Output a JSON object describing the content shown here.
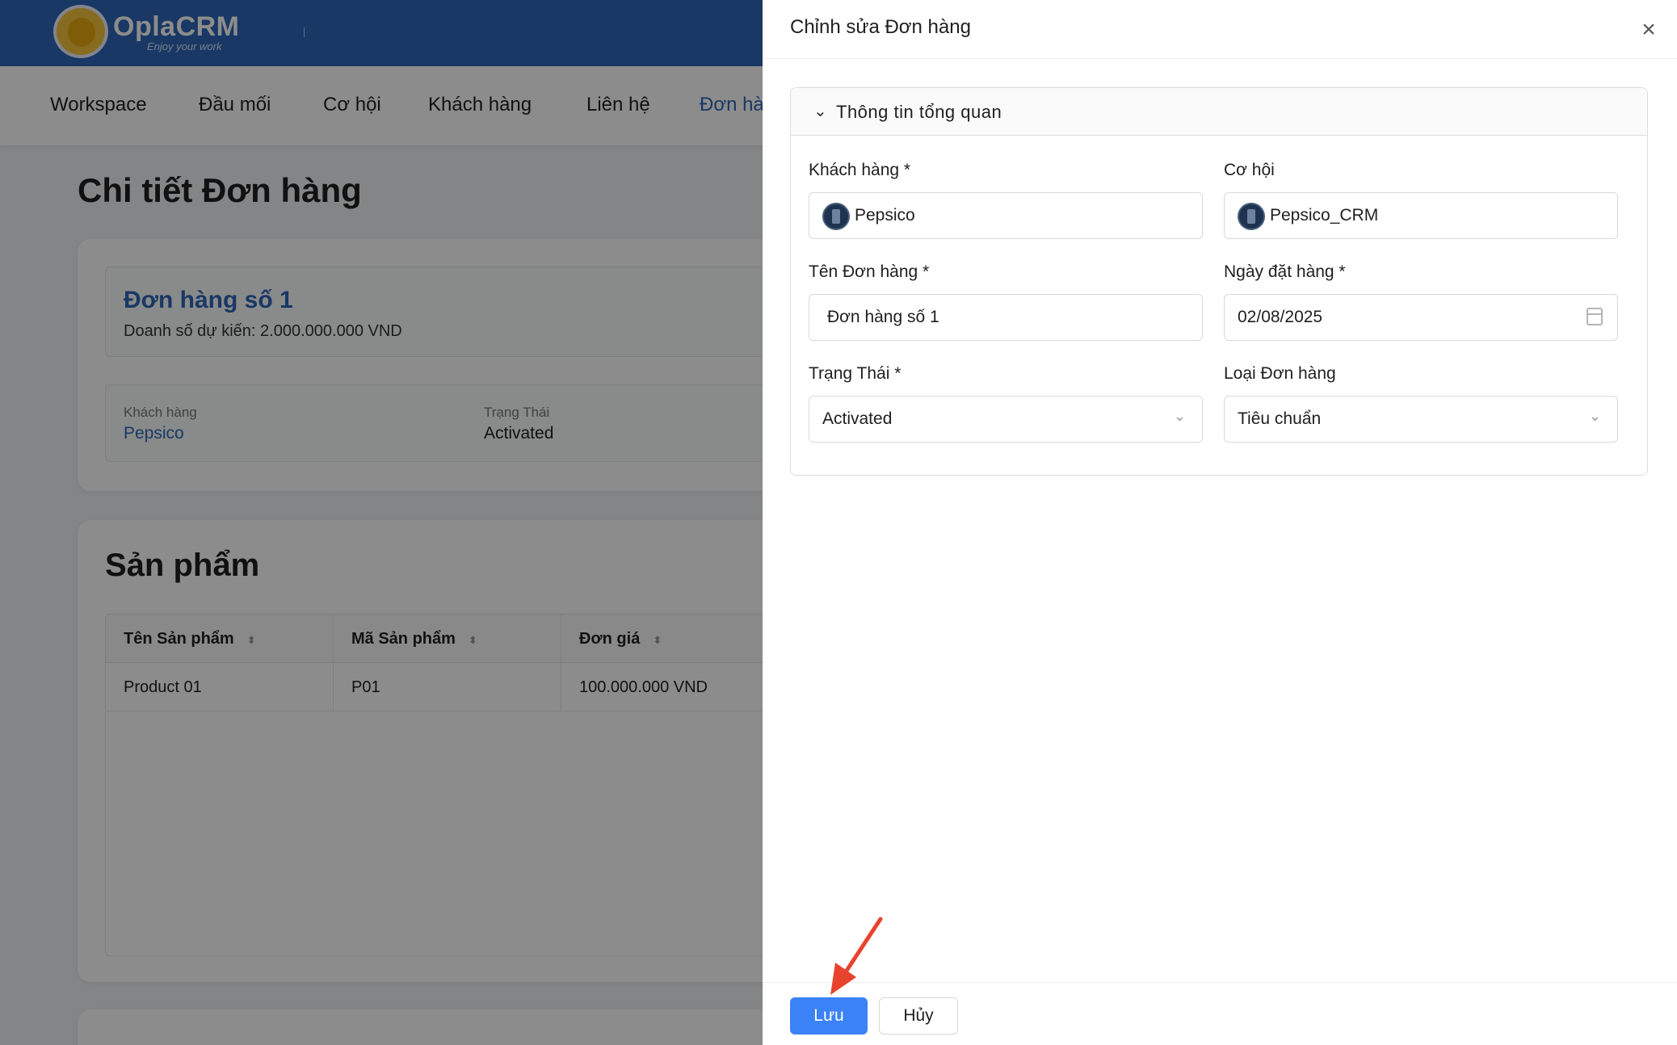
{
  "app": {
    "name": "OplaCRM",
    "tagline": "Enjoy your work"
  },
  "nav": {
    "items": [
      "Workspace",
      "Đầu mối",
      "Cơ hội",
      "Khách hàng",
      "Liên hệ",
      "Đơn hà"
    ]
  },
  "page": {
    "title": "Chi tiết Đơn hàng"
  },
  "order_card": {
    "title": "Đơn hàng số 1",
    "subtitle": "Doanh số dự kiến: 2.000.000.000 VND",
    "customer_label": "Khách hàng",
    "customer_value": "Pepsico",
    "status_label": "Trạng Thái",
    "status_value": "Activated"
  },
  "products": {
    "title": "Sản phẩm",
    "columns": [
      "Tên Sản phẩm",
      "Mã Sản phẩm",
      "Đơn giá"
    ],
    "rows": [
      [
        "Product 01",
        "P01",
        "100.000.000 VND"
      ]
    ]
  },
  "drawer": {
    "title": "Chỉnh sửa Đơn hàng",
    "section_title": "Thông tin tổng quan",
    "fields": {
      "customer": {
        "label": "Khách hàng *",
        "value": "Pepsico"
      },
      "opportunity": {
        "label": "Cơ hội",
        "value": "Pepsico_CRM"
      },
      "order_name": {
        "label": "Tên Đơn hàng *",
        "value": "Đơn hàng số 1"
      },
      "order_date": {
        "label": "Ngày đặt hàng *",
        "value": "02/08/2025"
      },
      "status": {
        "label": "Trạng Thái *",
        "value": "Activated"
      },
      "order_type": {
        "label": "Loại Đơn hàng",
        "value": "Tiêu chuẩn"
      }
    },
    "save_label": "Lưu",
    "cancel_label": "Hủy"
  },
  "colors": {
    "brand": "#2f66b8",
    "primary_button": "#3b82f6",
    "annotation_arrow": "#e8432d"
  }
}
